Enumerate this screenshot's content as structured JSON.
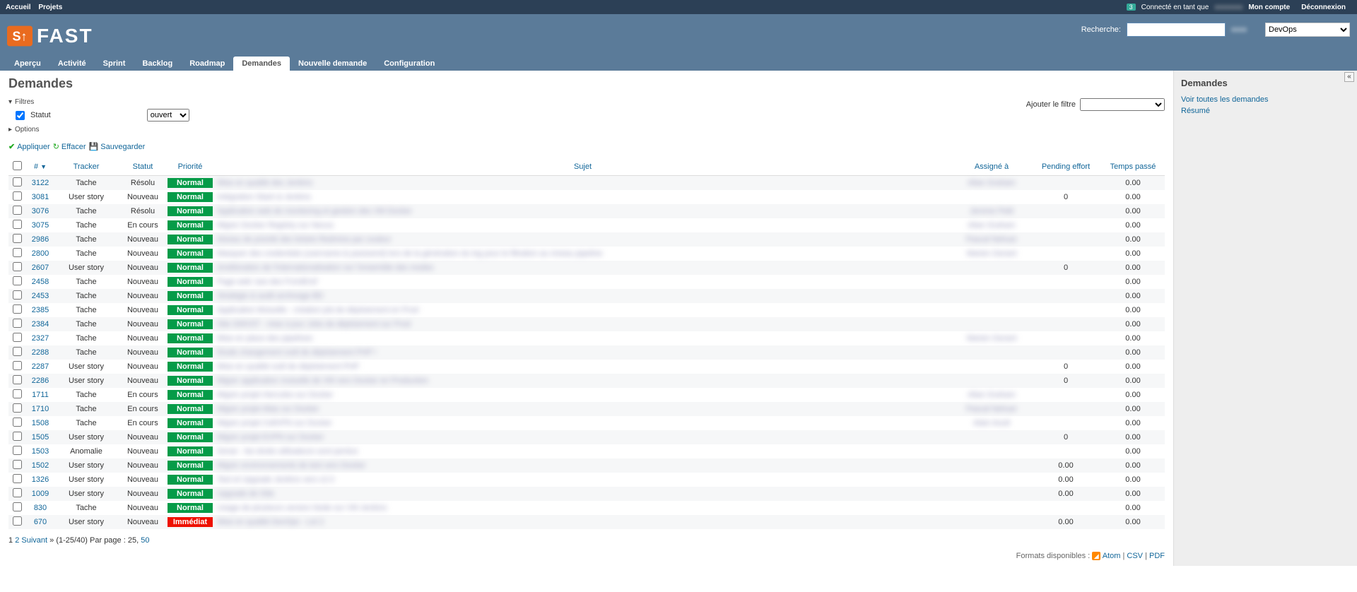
{
  "top": {
    "home": "Accueil",
    "projects": "Projets",
    "badge": "3",
    "logged_as": "Connecté en tant que",
    "user_hidden": "xxxxxxxx",
    "my_account": "Mon compte",
    "logout": "Déconnexion"
  },
  "header": {
    "logo_text": "FAST",
    "search_label": "Recherche:",
    "project_select": "DevOps"
  },
  "main_menu": [
    {
      "label": "Aperçu",
      "sel": false
    },
    {
      "label": "Activité",
      "sel": false
    },
    {
      "label": "Sprint",
      "sel": false
    },
    {
      "label": "Backlog",
      "sel": false
    },
    {
      "label": "Roadmap",
      "sel": false
    },
    {
      "label": "Demandes",
      "sel": true
    },
    {
      "label": "Nouvelle demande",
      "sel": false
    },
    {
      "label": "Configuration",
      "sel": false
    }
  ],
  "page_title": "Demandes",
  "filters": {
    "legend": "Filtres",
    "status_label": "Statut",
    "status_value": "ouvert",
    "options_legend": "Options",
    "add_filter_label": "Ajouter le filtre"
  },
  "buttons": {
    "apply": "Appliquer",
    "clear": "Effacer",
    "save": "Sauvegarder"
  },
  "columns": {
    "id": "#",
    "tracker": "Tracker",
    "status": "Statut",
    "priority": "Priorité",
    "subject": "Sujet",
    "assigned": "Assigné à",
    "pending": "Pending effort",
    "time": "Temps passé"
  },
  "rows": [
    {
      "id": "3122",
      "tracker": "Tache",
      "status": "Résolu",
      "prio": "Normal",
      "subject": "Mise en qualité des Jenkins",
      "assigned": "Alian Graham",
      "pending": "",
      "time": "0.00"
    },
    {
      "id": "3081",
      "tracker": "User story",
      "status": "Nouveau",
      "prio": "Normal",
      "subject": "Intégration Slack & Jenkins",
      "assigned": "",
      "pending": "0",
      "time": "0.00"
    },
    {
      "id": "3076",
      "tracker": "Tache",
      "status": "Résolu",
      "prio": "Normal",
      "subject": "Application web de monitoring et gestion des VM Docker",
      "assigned": "Jerome Petit",
      "pending": "",
      "time": "0.00"
    },
    {
      "id": "3075",
      "tracker": "Tache",
      "status": "En cours",
      "prio": "Normal",
      "subject": "Migrer Docker Registry sur Nexus",
      "assigned": "Alian Graham",
      "pending": "",
      "time": "0.00"
    },
    {
      "id": "2986",
      "tracker": "Tache",
      "status": "Nouveau",
      "prio": "Normal",
      "subject": "Niveau de priorité des tickets Redmine par couleur",
      "assigned": "Pascal Nehuer",
      "pending": "",
      "time": "0.00"
    },
    {
      "id": "2800",
      "tracker": "Tache",
      "status": "Nouveau",
      "prio": "Normal",
      "subject": "Masquer des credentials (username & password) lors de la génération du log pour le filtration au niveau pipeline",
      "assigned": "Marien Gerant",
      "pending": "",
      "time": "0.00"
    },
    {
      "id": "2607",
      "tracker": "User story",
      "status": "Nouveau",
      "prio": "Normal",
      "subject": "Amélioration de l'internationalisation sur l'ensemble des modes",
      "assigned": "",
      "pending": "0",
      "time": "0.00"
    },
    {
      "id": "2458",
      "tracker": "Tache",
      "status": "Nouveau",
      "prio": "Normal",
      "subject": "Page web 'axe des FrontEnd'",
      "assigned": "",
      "pending": "",
      "time": "0.00"
    },
    {
      "id": "2453",
      "tracker": "Tache",
      "status": "Nouveau",
      "prio": "Normal",
      "subject": "Stratégie & audit archivage BD",
      "assigned": "",
      "pending": "",
      "time": "0.00"
    },
    {
      "id": "2385",
      "tracker": "Tache",
      "status": "Nouveau",
      "prio": "Normal",
      "subject": "Application Mutuelle - création job de déploiement en Prod",
      "assigned": "",
      "pending": "",
      "time": "0.00"
    },
    {
      "id": "2384",
      "tracker": "Tache",
      "status": "Nouveau",
      "prio": "Normal",
      "subject": "Site GMVST - mise à jour Jobs de déploiement sur Prod",
      "assigned": "",
      "pending": "",
      "time": "0.00"
    },
    {
      "id": "2327",
      "tracker": "Tache",
      "status": "Nouveau",
      "prio": "Normal",
      "subject": "Mise en place des pipelines",
      "assigned": "Marien Gerant",
      "pending": "",
      "time": "0.00"
    },
    {
      "id": "2288",
      "tracker": "Tache",
      "status": "Nouveau",
      "prio": "Normal",
      "subject": "Etude changement outil de déploiement PHP !",
      "assigned": "",
      "pending": "",
      "time": "0.00"
    },
    {
      "id": "2287",
      "tracker": "User story",
      "status": "Nouveau",
      "prio": "Normal",
      "subject": "Mise en qualité outil de déploiement PHP",
      "assigned": "",
      "pending": "0",
      "time": "0.00"
    },
    {
      "id": "2286",
      "tracker": "User story",
      "status": "Nouveau",
      "prio": "Normal",
      "subject": "Migrer application mutuelle de VM vers Docker en Production",
      "assigned": "",
      "pending": "0",
      "time": "0.00"
    },
    {
      "id": "1711",
      "tracker": "Tache",
      "status": "En cours",
      "prio": "Normal",
      "subject": "Migrer projet Hercules sur Docker",
      "assigned": "Alian Graham",
      "pending": "",
      "time": "0.00"
    },
    {
      "id": "1710",
      "tracker": "Tache",
      "status": "En cours",
      "prio": "Normal",
      "subject": "Migrer projet Alias sur Docker",
      "assigned": "Pascal Nehuer",
      "pending": "",
      "time": "0.00"
    },
    {
      "id": "1508",
      "tracker": "Tache",
      "status": "En cours",
      "prio": "Normal",
      "subject": "Migrer projet CellVPN sur Docker",
      "assigned": "Alain Aoult",
      "pending": "",
      "time": "0.00"
    },
    {
      "id": "1505",
      "tracker": "User story",
      "status": "Nouveau",
      "prio": "Normal",
      "subject": "Migrer projet EVPN sur Docker",
      "assigned": "",
      "pending": "0",
      "time": "0.00"
    },
    {
      "id": "1503",
      "tracker": "Anomalie",
      "status": "Nouveau",
      "prio": "Normal",
      "subject": "Sonar - les droits utilisateurs sont perdus",
      "assigned": "",
      "pending": "",
      "time": "0.00"
    },
    {
      "id": "1502",
      "tracker": "User story",
      "status": "Nouveau",
      "prio": "Normal",
      "subject": "Migrer environnements de test vers Docker",
      "assigned": "",
      "pending": "0.00",
      "time": "0.00"
    },
    {
      "id": "1326",
      "tracker": "User story",
      "status": "Nouveau",
      "prio": "Normal",
      "subject": "Test et Upgrade Jenkins vers v2.0",
      "assigned": "",
      "pending": "0.00",
      "time": "0.00"
    },
    {
      "id": "1009",
      "tracker": "User story",
      "status": "Nouveau",
      "prio": "Normal",
      "subject": "Upgrade de Gite",
      "assigned": "",
      "pending": "0.00",
      "time": "0.00"
    },
    {
      "id": "830",
      "tracker": "Tache",
      "status": "Nouveau",
      "prio": "Normal",
      "subject": "Usage de plusieurs version Node sur VM Jenkins",
      "assigned": "",
      "pending": "",
      "time": "0.00"
    },
    {
      "id": "670",
      "tracker": "User story",
      "status": "Nouveau",
      "prio": "Immédiat",
      "subject": "Mise en qualité DevOps - Lot 2",
      "assigned": "",
      "pending": "0.00",
      "time": "0.00"
    }
  ],
  "pagination": {
    "page1": "1",
    "page2": "2",
    "next": "Suivant",
    "range": "(1-25/40)",
    "perpage": "Par page :",
    "pp25": "25",
    "pp50": "50"
  },
  "formats": {
    "label": "Formats disponibles :",
    "atom": "Atom",
    "csv": "CSV",
    "pdf": "PDF"
  },
  "sidebar": {
    "title": "Demandes",
    "all": "Voir toutes les demandes",
    "summary": "Résumé"
  }
}
